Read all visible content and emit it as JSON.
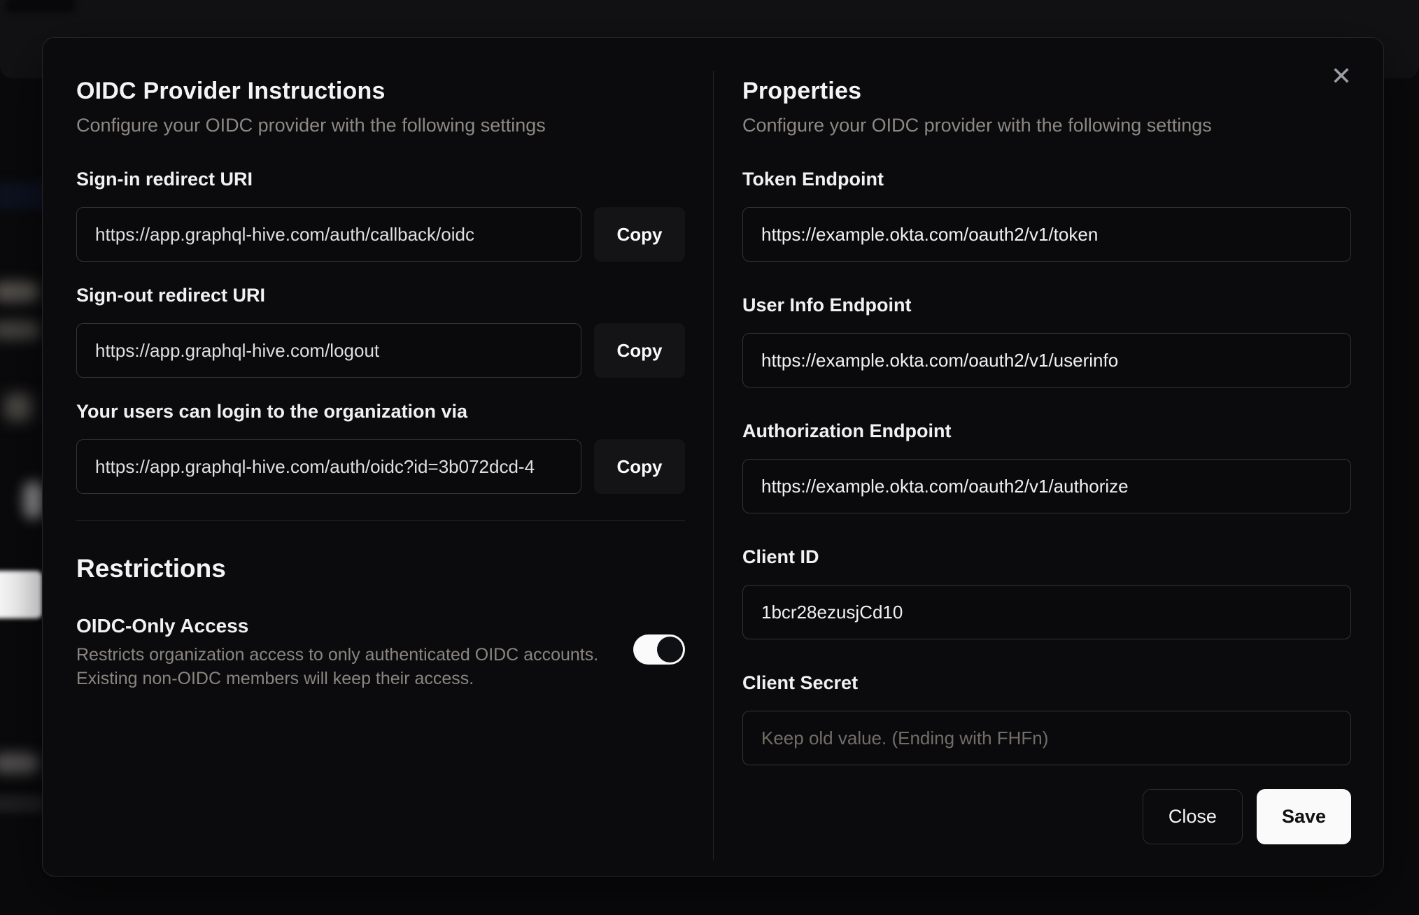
{
  "dialog": {
    "close_icon": "✕",
    "left": {
      "title": "OIDC Provider Instructions",
      "subtitle": "Configure your OIDC provider with the following settings",
      "fields": [
        {
          "label": "Sign-in redirect URI",
          "value": "https://app.graphql-hive.com/auth/callback/oidc",
          "copy_label": "Copy"
        },
        {
          "label": "Sign-out redirect URI",
          "value": "https://app.graphql-hive.com/logout",
          "copy_label": "Copy"
        },
        {
          "label": "Your users can login to the organization via",
          "value": "https://app.graphql-hive.com/auth/oidc?id=3b072dcd-4",
          "copy_label": "Copy"
        }
      ],
      "restrictions": {
        "title": "Restrictions",
        "toggle_label": "OIDC-Only Access",
        "toggle_description_line1": "Restricts organization access to only authenticated OIDC accounts.",
        "toggle_description_line2": "Existing non-OIDC members will keep their access.",
        "toggle_on": true
      }
    },
    "right": {
      "title": "Properties",
      "subtitle": "Configure your OIDC provider with the following settings",
      "fields": [
        {
          "label": "Token Endpoint",
          "value": "https://example.okta.com/oauth2/v1/token"
        },
        {
          "label": "User Info Endpoint",
          "value": "https://example.okta.com/oauth2/v1/userinfo"
        },
        {
          "label": "Authorization Endpoint",
          "value": "https://example.okta.com/oauth2/v1/authorize"
        },
        {
          "label": "Client ID",
          "value": "1bcr28ezusjCd10"
        },
        {
          "label": "Client Secret",
          "value": "",
          "placeholder": "Keep old value. (Ending with FHFn)"
        }
      ],
      "buttons": {
        "close": "Close",
        "save": "Save"
      }
    },
    "colors": {
      "dialog_bg": "#0b0b0d",
      "border": "#26262a",
      "input_border": "#37332d",
      "heading_text": "#f4f4f6",
      "muted_text": "#8d8882",
      "primary_button_bg": "#fafafa",
      "toggle_on": "#fafafa"
    }
  }
}
